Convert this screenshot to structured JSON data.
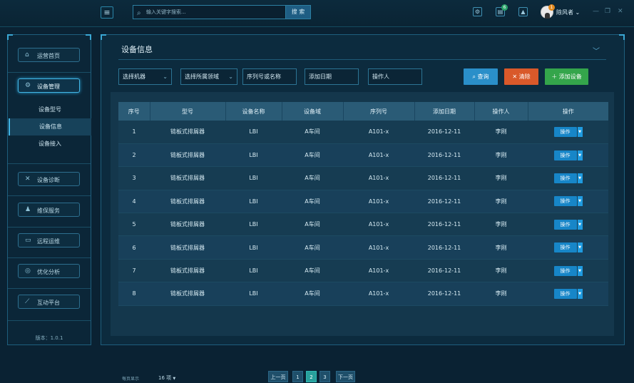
{
  "header": {
    "menu_icon": "hamburger-icon",
    "search_placeholder": "输入关键字搜索...",
    "search_button": "搜 索",
    "icons": [
      "settings-icon",
      "notice-icon",
      "alarm-icon"
    ],
    "notice_badge": "6",
    "user_badge": "1",
    "user_name": "除风者",
    "user_caret": "⌄"
  },
  "sidebar": {
    "items": [
      {
        "label": "运营首页",
        "icon": "home-icon"
      },
      {
        "label": "设备管理",
        "icon": "device-manage-icon"
      },
      {
        "label": "设备诊断",
        "icon": "tools-icon"
      },
      {
        "label": "维保服务",
        "icon": "service-icon"
      },
      {
        "label": "远程运维",
        "icon": "remote-icon"
      },
      {
        "label": "优化分析",
        "icon": "analysis-icon"
      },
      {
        "label": "互动平台",
        "icon": "trend-icon"
      }
    ],
    "sub_items": [
      "设备型号",
      "设备信息",
      "设备接入"
    ],
    "version": "版本：1.0.1"
  },
  "main": {
    "title": "设备信息",
    "filters": {
      "machine": "选择机器",
      "domain": "选择所属领域",
      "serial": "序列号或名称",
      "date": "添加日期",
      "operator": "操作人"
    },
    "buttons": {
      "query": "查询",
      "clear": "清除",
      "add": "添加设备"
    },
    "colors": {
      "query": "#2a8fc9",
      "clear": "#d9592a",
      "add": "#34a54b"
    },
    "table": {
      "headers": [
        "序号",
        "型号",
        "设备名称",
        "设备域",
        "序列号",
        "添加日期",
        "操作人",
        "操作"
      ],
      "op_label": "操作",
      "rows": [
        [
          "1",
          "链板式排屑器",
          "LBI",
          "A车间",
          "A101-x",
          "2016-12-11",
          "李刚"
        ],
        [
          "2",
          "链板式排屑器",
          "LBI",
          "A车间",
          "A101-x",
          "2016-12-11",
          "李刚"
        ],
        [
          "3",
          "链板式排屑器",
          "LBI",
          "A车间",
          "A101-x",
          "2016-12-11",
          "李刚"
        ],
        [
          "4",
          "链板式排屑器",
          "LBI",
          "A车间",
          "A101-x",
          "2016-12-11",
          "李刚"
        ],
        [
          "5",
          "链板式排屑器",
          "LBI",
          "A车间",
          "A101-x",
          "2016-12-11",
          "李刚"
        ],
        [
          "6",
          "链板式排屑器",
          "LBI",
          "A车间",
          "A101-x",
          "2016-12-11",
          "李刚"
        ],
        [
          "7",
          "链板式排屑器",
          "LBI",
          "A车间",
          "A101-x",
          "2016-12-11",
          "李刚"
        ],
        [
          "8",
          "链板式排屑器",
          "LBI",
          "A车间",
          "A101-x",
          "2016-12-11",
          "李刚"
        ]
      ]
    },
    "pagination": {
      "per_page_label": "每页显示",
      "per_page_value": "16 项",
      "prev": "上一页",
      "pages": [
        "1",
        "2",
        "3"
      ],
      "current": "2",
      "next": "下一页"
    }
  }
}
